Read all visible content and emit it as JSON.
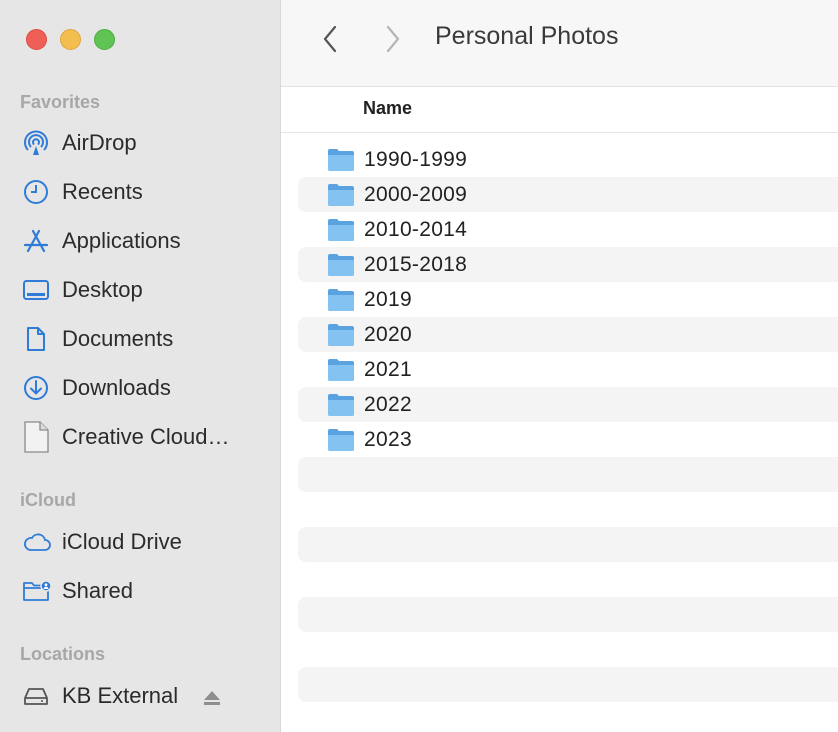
{
  "window": {
    "title": "Personal Photos"
  },
  "sidebar": {
    "sections": [
      {
        "title": "Favorites",
        "items": [
          {
            "label": "AirDrop",
            "icon": "airdrop-icon"
          },
          {
            "label": "Recents",
            "icon": "clock-icon"
          },
          {
            "label": "Applications",
            "icon": "applications-icon"
          },
          {
            "label": "Desktop",
            "icon": "desktop-icon"
          },
          {
            "label": "Documents",
            "icon": "document-icon"
          },
          {
            "label": "Downloads",
            "icon": "download-icon"
          },
          {
            "label": "Creative Cloud…",
            "icon": "generic-file-icon"
          }
        ]
      },
      {
        "title": "iCloud",
        "items": [
          {
            "label": "iCloud Drive",
            "icon": "cloud-icon"
          },
          {
            "label": "Shared",
            "icon": "shared-folder-icon"
          }
        ]
      },
      {
        "title": "Locations",
        "items": [
          {
            "label": "KB External",
            "icon": "external-drive-icon"
          }
        ]
      }
    ]
  },
  "list": {
    "column_name": "Name",
    "folders": [
      "1990-1999",
      "2000-2009",
      "2010-2014",
      "2015-2018",
      "2019",
      "2020",
      "2021",
      "2022",
      "2023"
    ]
  },
  "colors": {
    "sidebar_bg": "#e6e6e6",
    "accent_blue": "#2f7bd8",
    "folder_blue": "#6fb2ea",
    "row_alt": "#f4f4f4"
  }
}
